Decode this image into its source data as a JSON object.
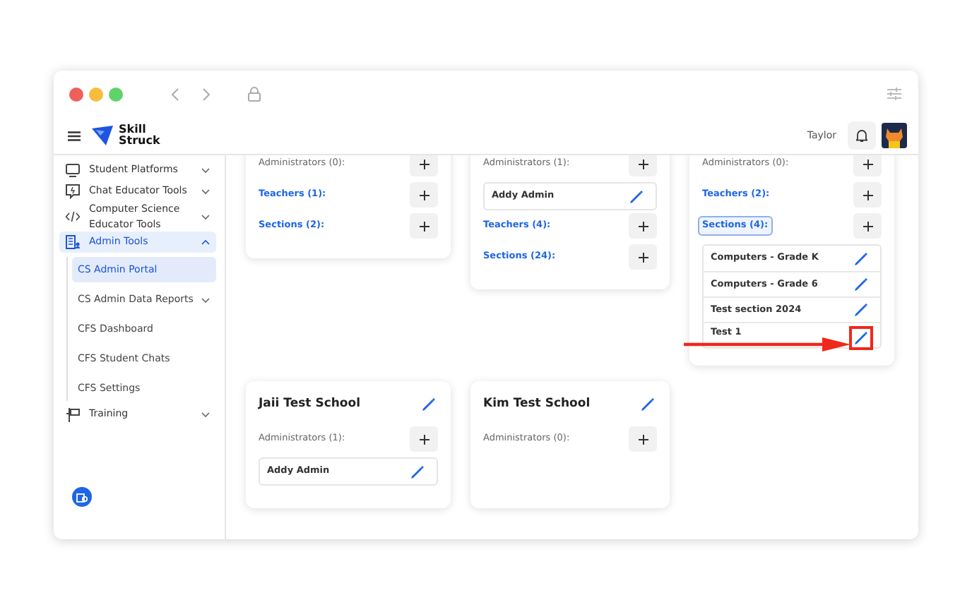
{
  "logo": {
    "line_1": "Skill",
    "line_2": "Struck"
  },
  "header": {
    "user_name": "Taylor"
  },
  "sidebar": {
    "items": [
      {
        "label": "Student Platforms",
        "expanded": false,
        "selected": false
      },
      {
        "label": "Chat Educator Tools",
        "expanded": false,
        "selected": false
      },
      {
        "label": "Computer Science Educator Tools",
        "expanded": false,
        "selected": false
      },
      {
        "label": "Admin Tools",
        "expanded": true,
        "selected": true,
        "children": [
          {
            "label": "CS Admin Portal",
            "selected": true,
            "expandable": false
          },
          {
            "label": "CS Admin Data Reports",
            "selected": false,
            "expandable": true
          },
          {
            "label": "CFS Dashboard",
            "selected": false,
            "expandable": false
          },
          {
            "label": "CFS Student Chats",
            "selected": false,
            "expandable": false
          },
          {
            "label": "CFS Settings",
            "selected": false,
            "expandable": false
          }
        ]
      },
      {
        "label": "Training",
        "expanded": false,
        "selected": false
      }
    ]
  },
  "card_rows": [
    [
      {
        "groups": [
          {
            "label": "Administrators (0):",
            "kind": "admins",
            "focused": false
          },
          {
            "label": "Teachers (1):",
            "kind": "teachers",
            "focused": false
          },
          {
            "label": "Sections (2):",
            "kind": "sections",
            "focused": false
          }
        ]
      },
      {
        "groups": [
          {
            "label": "Administrators (1):",
            "kind": "admins",
            "focused": false,
            "items": [
              {
                "label": "Addy Admin",
                "highlighted": false
              }
            ]
          },
          {
            "label": "Teachers (4):",
            "kind": "teachers",
            "focused": false
          },
          {
            "label": "Sections (24):",
            "kind": "sections",
            "focused": false
          }
        ]
      },
      {
        "groups": [
          {
            "label": "Administrators (0):",
            "kind": "admins",
            "focused": false
          },
          {
            "label": "Teachers (2):",
            "kind": "teachers",
            "focused": false
          },
          {
            "label": "Sections (4):",
            "kind": "sections",
            "focused": true,
            "items": [
              {
                "label": "Computers - Grade K",
                "highlighted": false
              },
              {
                "label": "Computers - Grade 6",
                "highlighted": false
              },
              {
                "label": "Test section 2024",
                "highlighted": false
              },
              {
                "label": "Test 1",
                "highlighted": true
              }
            ]
          }
        ]
      }
    ],
    [
      {
        "title": "Jaii Test School",
        "groups": [
          {
            "label": "Administrators (1):",
            "kind": "admins",
            "focused": false,
            "items": [
              {
                "label": "Addy Admin",
                "highlighted": false
              }
            ]
          }
        ]
      },
      {
        "title": "Kim Test School",
        "groups": [
          {
            "label": "Administrators (0):",
            "kind": "admins",
            "focused": false
          }
        ]
      }
    ]
  ]
}
